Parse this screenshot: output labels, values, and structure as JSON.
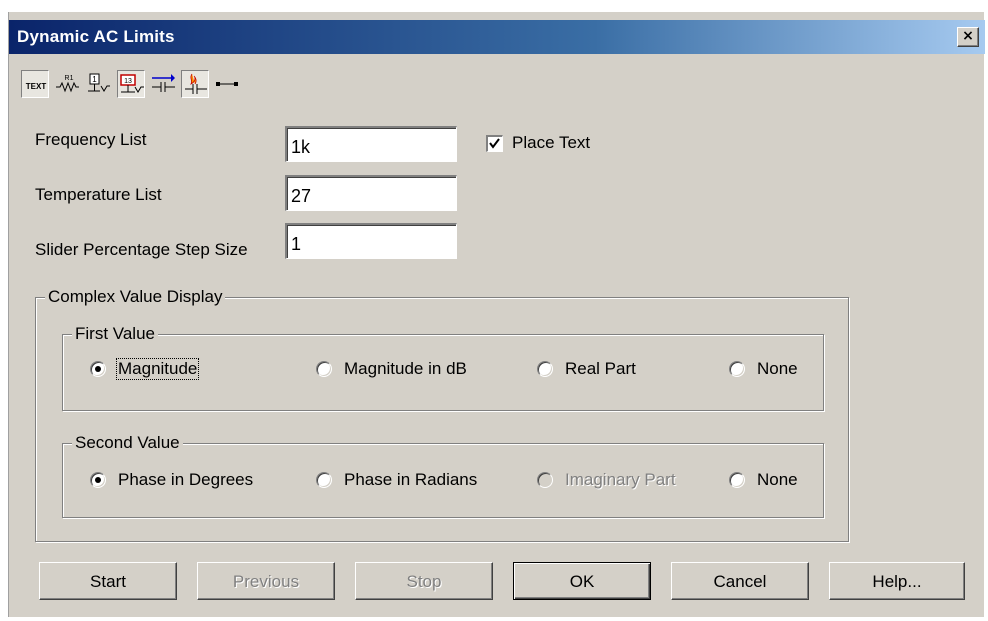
{
  "window": {
    "title": "Dynamic AC Limits",
    "close_label": "×"
  },
  "toolbar": {
    "text_icon_label": "TEXT",
    "resistor_icon_label": "R1",
    "numbered_icon_label": "13",
    "items": [
      {
        "icon": "text-icon"
      },
      {
        "icon": "resistor-label-icon"
      },
      {
        "icon": "node-number-icon"
      },
      {
        "icon": "node-voltage-icon"
      },
      {
        "icon": "current-flow-icon"
      },
      {
        "icon": "power-dissipation-icon"
      },
      {
        "icon": "pin-connection-icon"
      }
    ]
  },
  "fields": {
    "frequency": {
      "label": "Frequency List",
      "value": "1k"
    },
    "temperature": {
      "label": "Temperature List",
      "value": "27"
    },
    "slider": {
      "label": "Slider Percentage Step Size",
      "value": "1"
    }
  },
  "place_text": {
    "label": "Place Text",
    "checked": true
  },
  "complex_display": {
    "legend": "Complex Value Display",
    "first_value": {
      "legend": "First Value",
      "options": [
        "Magnitude",
        "Magnitude in dB",
        "Real Part",
        "None"
      ],
      "selected": "Magnitude"
    },
    "second_value": {
      "legend": "Second Value",
      "options": [
        "Phase in Degrees",
        "Phase in Radians",
        "Imaginary Part",
        "None"
      ],
      "selected": "Phase in Degrees",
      "disabled": [
        "Imaginary Part"
      ]
    }
  },
  "buttons": {
    "start": "Start",
    "previous": "Previous",
    "stop": "Stop",
    "ok": "OK",
    "cancel": "Cancel",
    "help": "Help..."
  }
}
